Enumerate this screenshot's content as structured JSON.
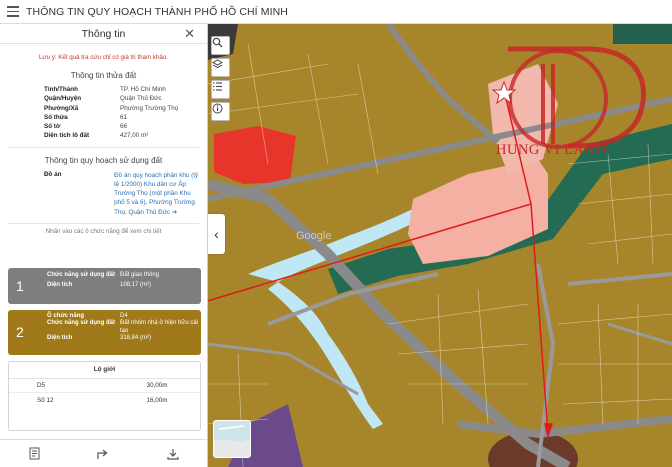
{
  "app": {
    "title": "THÔNG TIN QUY HOẠCH THÀNH PHỐ HỒ CHÍ MINH",
    "menu_icon": "hamburger-icon"
  },
  "panel": {
    "title": "Thông tin",
    "close_icon": "close-icon",
    "note": "Lưu ý: Kết quả tra cứu chỉ có giá trị tham khảo.",
    "parcel_section_title": "Thông tin thửa đất",
    "parcel": [
      {
        "label": "Tỉnh/Thành",
        "value": "TP. Hồ Chí Minh"
      },
      {
        "label": "Quận/Huyện",
        "value": "Quận Thủ Đức"
      },
      {
        "label": "Phường/Xã",
        "value": "Phường Trường Thọ"
      },
      {
        "label": "Số thửa",
        "value": "61"
      },
      {
        "label": "Số tờ",
        "value": "66"
      },
      {
        "label": "Diện tích lô đất",
        "value": "427,00 m²"
      }
    ],
    "plan_section_title": "Thông tin quy hoạch sử dụng đất",
    "doan_label": "Đồ án",
    "doan_value": "Đồ án quy hoạch phân khu (tỷ lệ 1/2000) Khu dân cư Ấp Trường Thọ (một phần Khu phố 5 và 6), Phường Trường Thọ, Quận Thủ Đức ➔",
    "hint": "Nhấn vào các ô chức năng để xem chi tiết",
    "cards": [
      {
        "number": "1",
        "rows": [
          {
            "label": "Chức năng sử dụng đất",
            "value": "Đất giao thông"
          },
          {
            "label": "Diện tích",
            "value": "108,17 (m²)"
          }
        ]
      },
      {
        "number": "2",
        "rows": [
          {
            "label": "Ô chức năng",
            "value": "D4"
          },
          {
            "label": "Chức năng sử dụng đất",
            "value": "Đất nhóm nhà ở hiện hữu cải tạo"
          },
          {
            "label": "Diện tích",
            "value": "318,84 (m²)"
          }
        ]
      }
    ],
    "lo_gioi": {
      "title": "Lộ giới",
      "rows": [
        {
          "road": "D5",
          "width": "30,00m"
        },
        {
          "road": "Số 12",
          "width": "16,00m"
        }
      ]
    },
    "footer_icons": [
      "document-icon",
      "share-icon",
      "download-icon"
    ]
  },
  "map": {
    "tools": [
      "search-icon",
      "layers-icon",
      "list-icon",
      "info-icon"
    ],
    "collapse_icon": "chevron-left-icon",
    "watermark_text": "HUNG VI LAND",
    "faint_watermark": "Google",
    "colors": {
      "residential": "#b5972f",
      "traffic": "#7f7f7f",
      "water": "#bfe7f5",
      "green": "#246b53",
      "commercial": "#e7352b",
      "highlight": "#f4b0a2",
      "arrow": "#e01b1b",
      "brand_red": "#c62828",
      "card1": "#7e7e7e",
      "card2": "#a07a1a"
    }
  }
}
